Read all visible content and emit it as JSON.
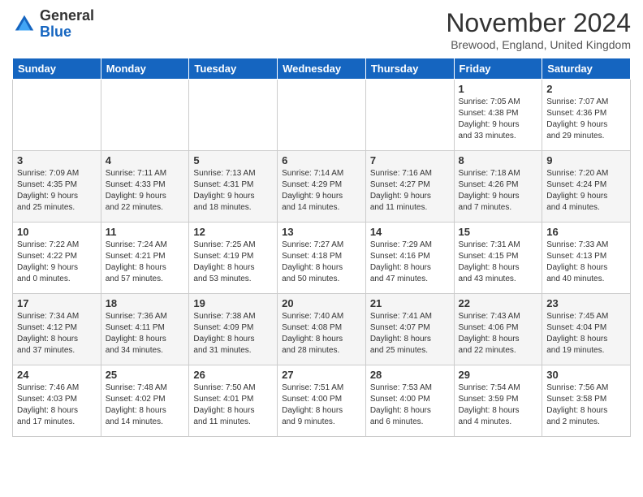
{
  "logo": {
    "line1": "General",
    "line2": "Blue"
  },
  "title": "November 2024",
  "location": "Brewood, England, United Kingdom",
  "days_of_week": [
    "Sunday",
    "Monday",
    "Tuesday",
    "Wednesday",
    "Thursday",
    "Friday",
    "Saturday"
  ],
  "weeks": [
    [
      {
        "day": "",
        "info": ""
      },
      {
        "day": "",
        "info": ""
      },
      {
        "day": "",
        "info": ""
      },
      {
        "day": "",
        "info": ""
      },
      {
        "day": "",
        "info": ""
      },
      {
        "day": "1",
        "info": "Sunrise: 7:05 AM\nSunset: 4:38 PM\nDaylight: 9 hours\nand 33 minutes."
      },
      {
        "day": "2",
        "info": "Sunrise: 7:07 AM\nSunset: 4:36 PM\nDaylight: 9 hours\nand 29 minutes."
      }
    ],
    [
      {
        "day": "3",
        "info": "Sunrise: 7:09 AM\nSunset: 4:35 PM\nDaylight: 9 hours\nand 25 minutes."
      },
      {
        "day": "4",
        "info": "Sunrise: 7:11 AM\nSunset: 4:33 PM\nDaylight: 9 hours\nand 22 minutes."
      },
      {
        "day": "5",
        "info": "Sunrise: 7:13 AM\nSunset: 4:31 PM\nDaylight: 9 hours\nand 18 minutes."
      },
      {
        "day": "6",
        "info": "Sunrise: 7:14 AM\nSunset: 4:29 PM\nDaylight: 9 hours\nand 14 minutes."
      },
      {
        "day": "7",
        "info": "Sunrise: 7:16 AM\nSunset: 4:27 PM\nDaylight: 9 hours\nand 11 minutes."
      },
      {
        "day": "8",
        "info": "Sunrise: 7:18 AM\nSunset: 4:26 PM\nDaylight: 9 hours\nand 7 minutes."
      },
      {
        "day": "9",
        "info": "Sunrise: 7:20 AM\nSunset: 4:24 PM\nDaylight: 9 hours\nand 4 minutes."
      }
    ],
    [
      {
        "day": "10",
        "info": "Sunrise: 7:22 AM\nSunset: 4:22 PM\nDaylight: 9 hours\nand 0 minutes."
      },
      {
        "day": "11",
        "info": "Sunrise: 7:24 AM\nSunset: 4:21 PM\nDaylight: 8 hours\nand 57 minutes."
      },
      {
        "day": "12",
        "info": "Sunrise: 7:25 AM\nSunset: 4:19 PM\nDaylight: 8 hours\nand 53 minutes."
      },
      {
        "day": "13",
        "info": "Sunrise: 7:27 AM\nSunset: 4:18 PM\nDaylight: 8 hours\nand 50 minutes."
      },
      {
        "day": "14",
        "info": "Sunrise: 7:29 AM\nSunset: 4:16 PM\nDaylight: 8 hours\nand 47 minutes."
      },
      {
        "day": "15",
        "info": "Sunrise: 7:31 AM\nSunset: 4:15 PM\nDaylight: 8 hours\nand 43 minutes."
      },
      {
        "day": "16",
        "info": "Sunrise: 7:33 AM\nSunset: 4:13 PM\nDaylight: 8 hours\nand 40 minutes."
      }
    ],
    [
      {
        "day": "17",
        "info": "Sunrise: 7:34 AM\nSunset: 4:12 PM\nDaylight: 8 hours\nand 37 minutes."
      },
      {
        "day": "18",
        "info": "Sunrise: 7:36 AM\nSunset: 4:11 PM\nDaylight: 8 hours\nand 34 minutes."
      },
      {
        "day": "19",
        "info": "Sunrise: 7:38 AM\nSunset: 4:09 PM\nDaylight: 8 hours\nand 31 minutes."
      },
      {
        "day": "20",
        "info": "Sunrise: 7:40 AM\nSunset: 4:08 PM\nDaylight: 8 hours\nand 28 minutes."
      },
      {
        "day": "21",
        "info": "Sunrise: 7:41 AM\nSunset: 4:07 PM\nDaylight: 8 hours\nand 25 minutes."
      },
      {
        "day": "22",
        "info": "Sunrise: 7:43 AM\nSunset: 4:06 PM\nDaylight: 8 hours\nand 22 minutes."
      },
      {
        "day": "23",
        "info": "Sunrise: 7:45 AM\nSunset: 4:04 PM\nDaylight: 8 hours\nand 19 minutes."
      }
    ],
    [
      {
        "day": "24",
        "info": "Sunrise: 7:46 AM\nSunset: 4:03 PM\nDaylight: 8 hours\nand 17 minutes."
      },
      {
        "day": "25",
        "info": "Sunrise: 7:48 AM\nSunset: 4:02 PM\nDaylight: 8 hours\nand 14 minutes."
      },
      {
        "day": "26",
        "info": "Sunrise: 7:50 AM\nSunset: 4:01 PM\nDaylight: 8 hours\nand 11 minutes."
      },
      {
        "day": "27",
        "info": "Sunrise: 7:51 AM\nSunset: 4:00 PM\nDaylight: 8 hours\nand 9 minutes."
      },
      {
        "day": "28",
        "info": "Sunrise: 7:53 AM\nSunset: 4:00 PM\nDaylight: 8 hours\nand 6 minutes."
      },
      {
        "day": "29",
        "info": "Sunrise: 7:54 AM\nSunset: 3:59 PM\nDaylight: 8 hours\nand 4 minutes."
      },
      {
        "day": "30",
        "info": "Sunrise: 7:56 AM\nSunset: 3:58 PM\nDaylight: 8 hours\nand 2 minutes."
      }
    ]
  ]
}
